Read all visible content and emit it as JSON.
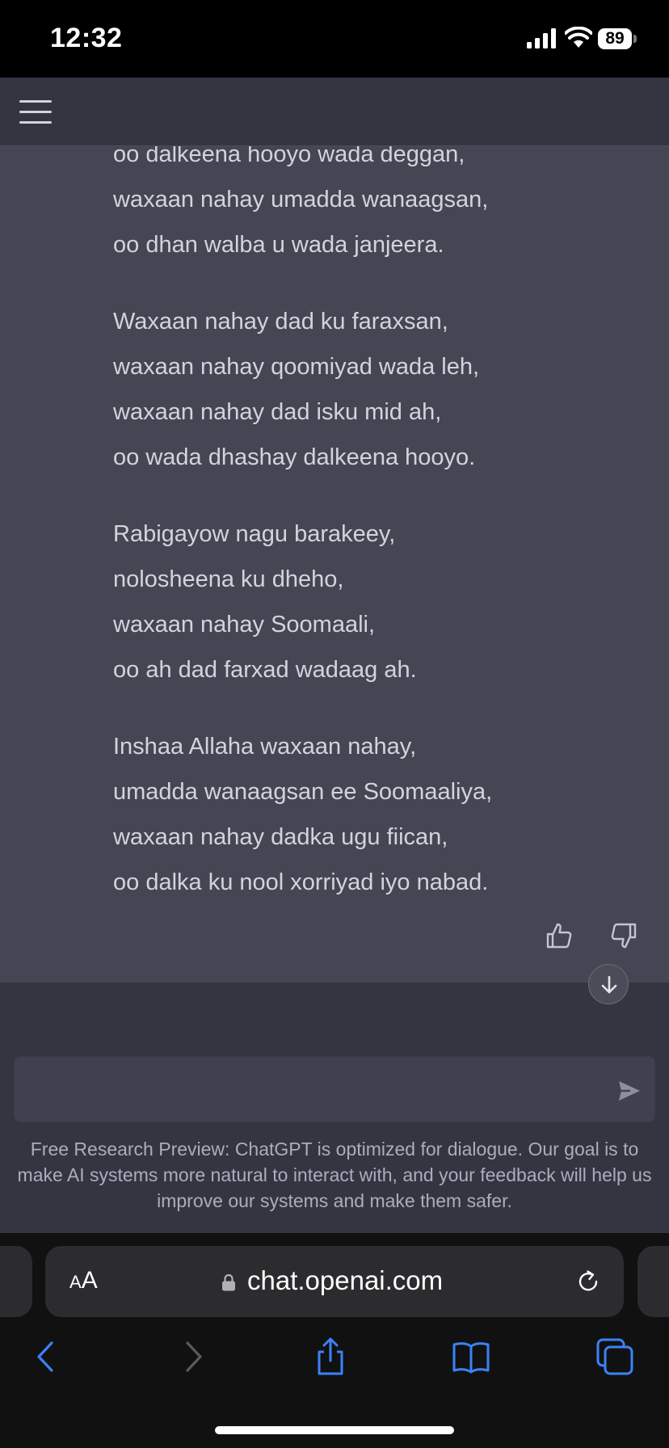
{
  "status_bar": {
    "time": "12:32",
    "battery": "89"
  },
  "header": {
    "menu_icon": "hamburger-menu-icon"
  },
  "message": {
    "stanzas": [
      [
        "oo dalkeena hooyo wada deggan,",
        "waxaan nahay umadda wanaagsan,",
        "oo dhan walba u wada janjeera."
      ],
      [
        "Waxaan nahay dad ku faraxsan,",
        "waxaan nahay qoomiyad wada leh,",
        "waxaan nahay dad isku mid ah,",
        "oo wada dhashay dalkeena hooyo."
      ],
      [
        "Rabigayow nagu barakeey,",
        "nolosheena ku dheho,",
        "waxaan nahay Soomaali,",
        "oo ah dad farxad wadaag ah."
      ],
      [
        "Inshaa Allaha waxaan nahay,",
        "umadda wanaagsan ee Soomaaliya,",
        "waxaan nahay dadka ugu fiican,",
        "oo dalka ku nool xorriyad iyo nabad."
      ]
    ],
    "feedback_icons": [
      "thumbs-up-icon",
      "thumbs-down-icon"
    ]
  },
  "composer": {
    "value": "",
    "placeholder": "",
    "send_icon": "send-icon"
  },
  "disclaimer": "Free Research Preview: ChatGPT is optimized for dialogue. Our goal is to make AI systems more natural to interact with, and your feedback will help us improve our systems and make them safer.",
  "browser": {
    "text_size_label": "AA",
    "url": "chat.openai.com",
    "toolbar_icons": [
      "back-icon",
      "forward-icon",
      "share-icon",
      "bookmarks-icon",
      "tabs-icon"
    ]
  },
  "colors": {
    "message_bg": "#444654",
    "app_bg": "#343541",
    "text": "#d1d5db",
    "safari_accent": "#3b82f6"
  }
}
